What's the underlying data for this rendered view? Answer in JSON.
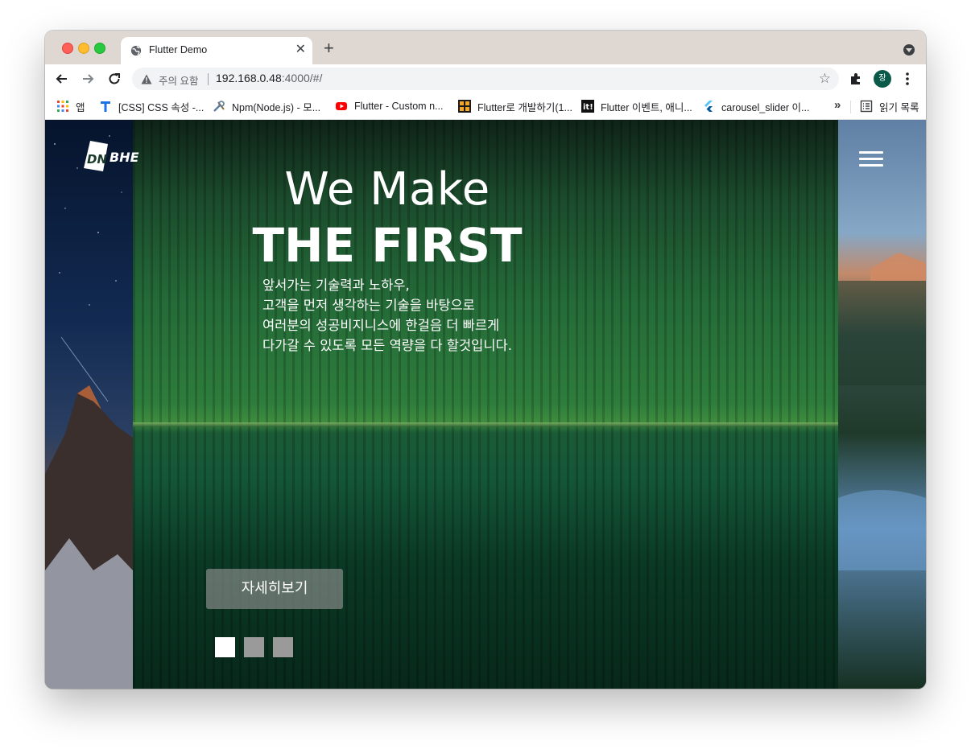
{
  "browser": {
    "tab_title": "Flutter Demo",
    "security_label": "주의 요함",
    "url_host": "192.168.0.48",
    "url_path": ":4000/#/",
    "avatar_initial": "장"
  },
  "bookmarks": {
    "items": [
      {
        "label": "앱",
        "icon": "apps-grid-icon"
      },
      {
        "label": "[CSS] CSS 속성 -...",
        "icon": "t-letter-icon"
      },
      {
        "label": "Npm(Node.js) - 모...",
        "icon": "tools-icon"
      },
      {
        "label": "Flutter - Custom n...",
        "icon": "youtube-icon"
      },
      {
        "label": "Flutter로 개발하기(1...",
        "icon": "orange-grid-icon"
      },
      {
        "label": "Flutter 이벤트, 애니...",
        "icon": "it-badge-icon"
      },
      {
        "label": "carousel_slider 이...",
        "icon": "flutter-icon"
      }
    ],
    "more": "»",
    "reading_list": "읽기 목록"
  },
  "page": {
    "logo_text": "DNBHE",
    "hero_title_line1": "We Make",
    "hero_title_line2": "THE FIRST",
    "hero_description": [
      "앞서가는 기술력과 노하우,",
      "고객을 먼저 생각하는 기술을 바탕으로",
      "여러분의 성공비지니스에 한걸음 더 빠르게",
      "다가갈 수 있도록 모든 역량을 다 할것입니다."
    ],
    "detail_button": "자세히보기",
    "carousel": {
      "total": 3,
      "active_index": 0
    }
  },
  "colors": {
    "tabstrip": "#dfd7d2",
    "button_bg": "rgba(150,150,150,0.62)",
    "dot_active": "#ffffff",
    "dot_inactive": "#9a9a9a"
  }
}
